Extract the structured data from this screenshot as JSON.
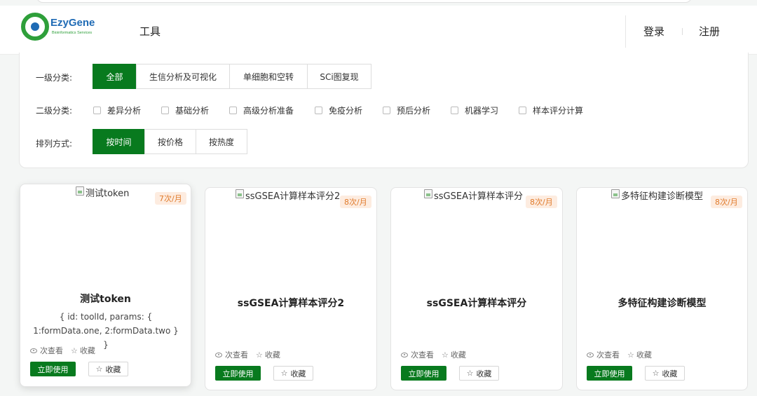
{
  "header": {
    "logo_name": "EzyGene",
    "logo_sub": "Bioinformatics Services",
    "nav_tools": "工具",
    "login": "登录",
    "register": "注册"
  },
  "filters": {
    "level1": {
      "label": "一级分类:",
      "options": [
        "全部",
        "生信分析及可视化",
        "单细胞和空转",
        "SCi图复现"
      ],
      "selected": "全部"
    },
    "level2": {
      "label": "二级分类:",
      "options": [
        "差异分析",
        "基础分析",
        "高级分析准备",
        "免疫分析",
        "预后分析",
        "机器学习",
        "样本评分计算"
      ]
    },
    "sort": {
      "label": "排列方式:",
      "options": [
        "按时间",
        "按价格",
        "按热度"
      ],
      "selected": "按时间"
    }
  },
  "cards": [
    {
      "image_alt": "测试token",
      "price": "7次/月",
      "title": "测试token",
      "description": "{ id: toolId, params: { 1:formData.one, 2:formData.two } }",
      "views": "次查看",
      "favorites": "收藏",
      "use_label": "立即使用",
      "fav_label": "收藏"
    },
    {
      "image_alt": "ssGSEA计算样本评分2",
      "price": "8次/月",
      "title": "ssGSEA计算样本评分2",
      "description": "",
      "views": "次查看",
      "favorites": "收藏",
      "use_label": "立即使用",
      "fav_label": "收藏"
    },
    {
      "image_alt": "ssGSEA计算样本评分",
      "price": "8次/月",
      "title": "ssGSEA计算样本评分",
      "description": "",
      "views": "次查看",
      "favorites": "收藏",
      "use_label": "立即使用",
      "fav_label": "收藏"
    },
    {
      "image_alt": "多特征构建诊断模型",
      "price": "8次/月",
      "title": "多特征构建诊断模型",
      "description": "",
      "views": "次查看",
      "favorites": "收藏",
      "use_label": "立即使用",
      "fav_label": "收藏"
    }
  ],
  "colors": {
    "brand_green": "#087a1e",
    "logo_blue": "#1f6bb5",
    "price_text": "#e07b2c",
    "price_bg": "#fdece0"
  }
}
